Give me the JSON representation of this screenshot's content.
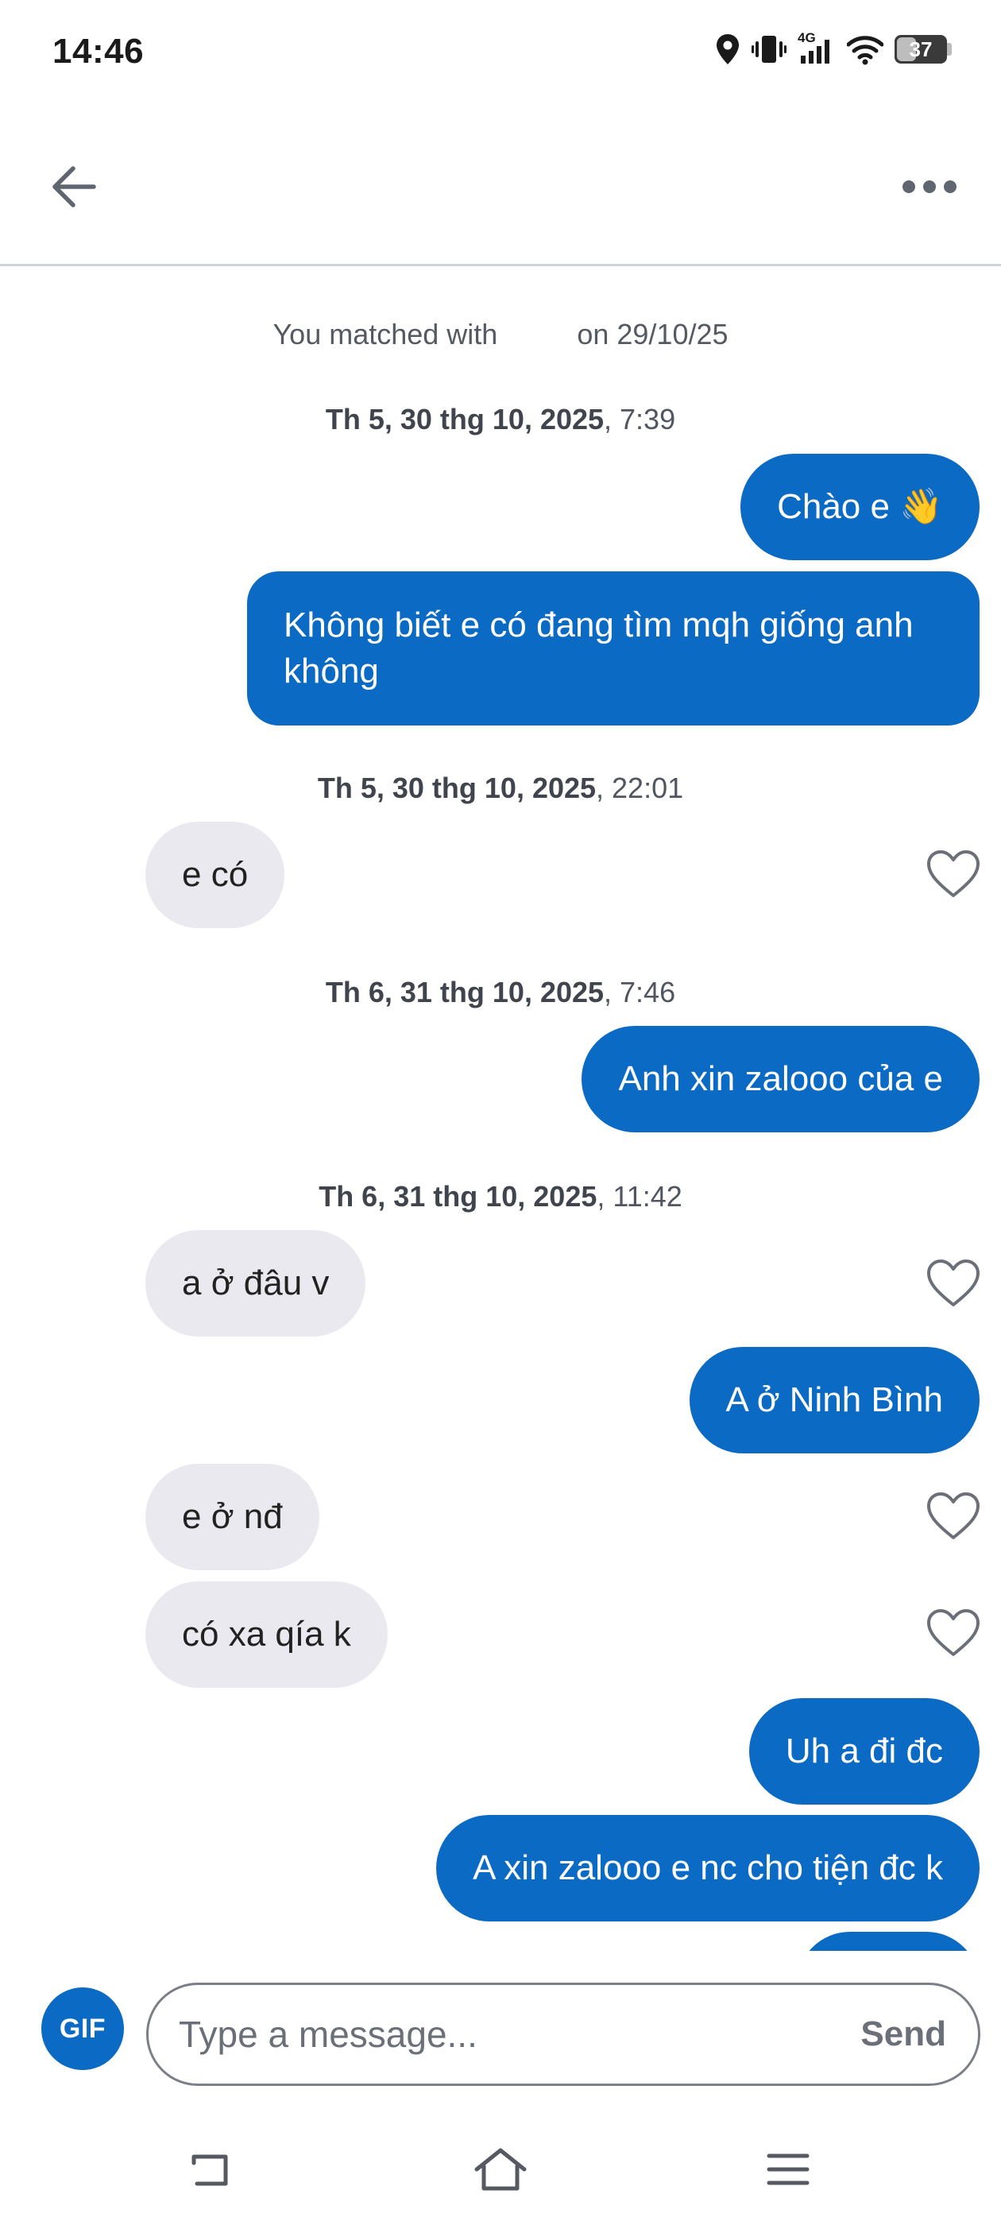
{
  "status_bar": {
    "time": "14:46",
    "network_label": "4G",
    "battery": "37",
    "icons": [
      "location-icon",
      "vibrate-icon",
      "cellular-4g-icon",
      "wifi-icon",
      "battery-icon"
    ]
  },
  "header": {
    "back_icon": "arrow-left-icon",
    "more_icon": "more-horizontal-icon"
  },
  "chat": {
    "match_prefix": "You matched with",
    "match_suffix": "on 29/10/25",
    "groups": [
      {
        "date": "Th 5, 30 thg 10, 2025",
        "time": ", 7:39"
      },
      {
        "date": "Th 5, 30 thg 10, 2025",
        "time": ", 22:01"
      },
      {
        "date": "Th 6, 31 thg 10, 2025",
        "time": ", 7:46"
      },
      {
        "date": "Th 6, 31 thg 10, 2025",
        "time": ", 11:42"
      }
    ],
    "messages": [
      {
        "dir": "out",
        "text": "Chào e 👋"
      },
      {
        "dir": "out",
        "text": "Không biết e có đang tìm mqh giống anh không"
      },
      {
        "dir": "in",
        "text": "e có"
      },
      {
        "dir": "out",
        "text": "Anh xin zalooo của e"
      },
      {
        "dir": "in",
        "text": "a ở đâu v"
      },
      {
        "dir": "out",
        "text": "A ở Ninh Bình"
      },
      {
        "dir": "in",
        "text": "e ở nđ"
      },
      {
        "dir": "in",
        "text": "có xa qía k"
      },
      {
        "dir": "out",
        "text": "Uh a đi đc"
      },
      {
        "dir": "out",
        "text": "A xin zalooo e nc cho tiện đc k"
      }
    ],
    "like_icon": "heart-outline-icon"
  },
  "composer": {
    "gif_label": "GIF",
    "placeholder": "Type a message...",
    "send_label": "Send"
  },
  "nav": {
    "back_icon": "nav-back-icon",
    "home_icon": "nav-home-icon",
    "menu_icon": "nav-menu-icon"
  },
  "colors": {
    "accent": "#0a6ac4",
    "incoming_bubble": "#e9e9ef",
    "muted_text": "#6b6f78"
  }
}
